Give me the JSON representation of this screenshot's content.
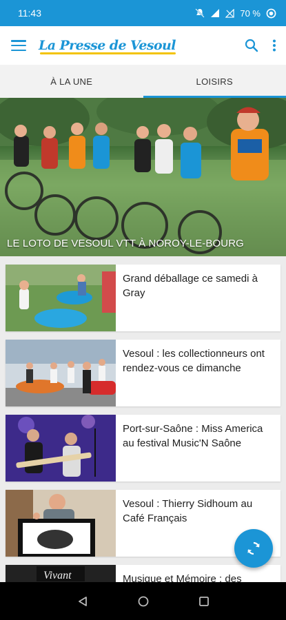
{
  "status_bar": {
    "time": "11:43",
    "battery": "70 %"
  },
  "app_bar": {
    "logo": "La Presse de Vesoul"
  },
  "tabs": [
    {
      "label": "À LA UNE",
      "active": false
    },
    {
      "label": "LOISIRS",
      "active": true
    }
  ],
  "hero": {
    "title": "LE LOTO DE VESOUL VTT À NOROY-LE-BOURG"
  },
  "articles": [
    {
      "title": "Grand déballage ce samedi à Gray"
    },
    {
      "title": "Vesoul : les collectionneurs ont rendez-vous ce dimanche"
    },
    {
      "title": "Port-sur-Saône : Miss America au festival Music'N Saône"
    },
    {
      "title": "Vesoul : Thierry Sidhoum au Café Français"
    },
    {
      "title": "Musique et Mémoire : des"
    }
  ],
  "colors": {
    "accent": "#1b95d6",
    "logo_underline": "#f3c300"
  },
  "icons": {
    "refresh_fab": "refresh-icon",
    "search": "search-icon",
    "more": "more-vert-icon"
  }
}
